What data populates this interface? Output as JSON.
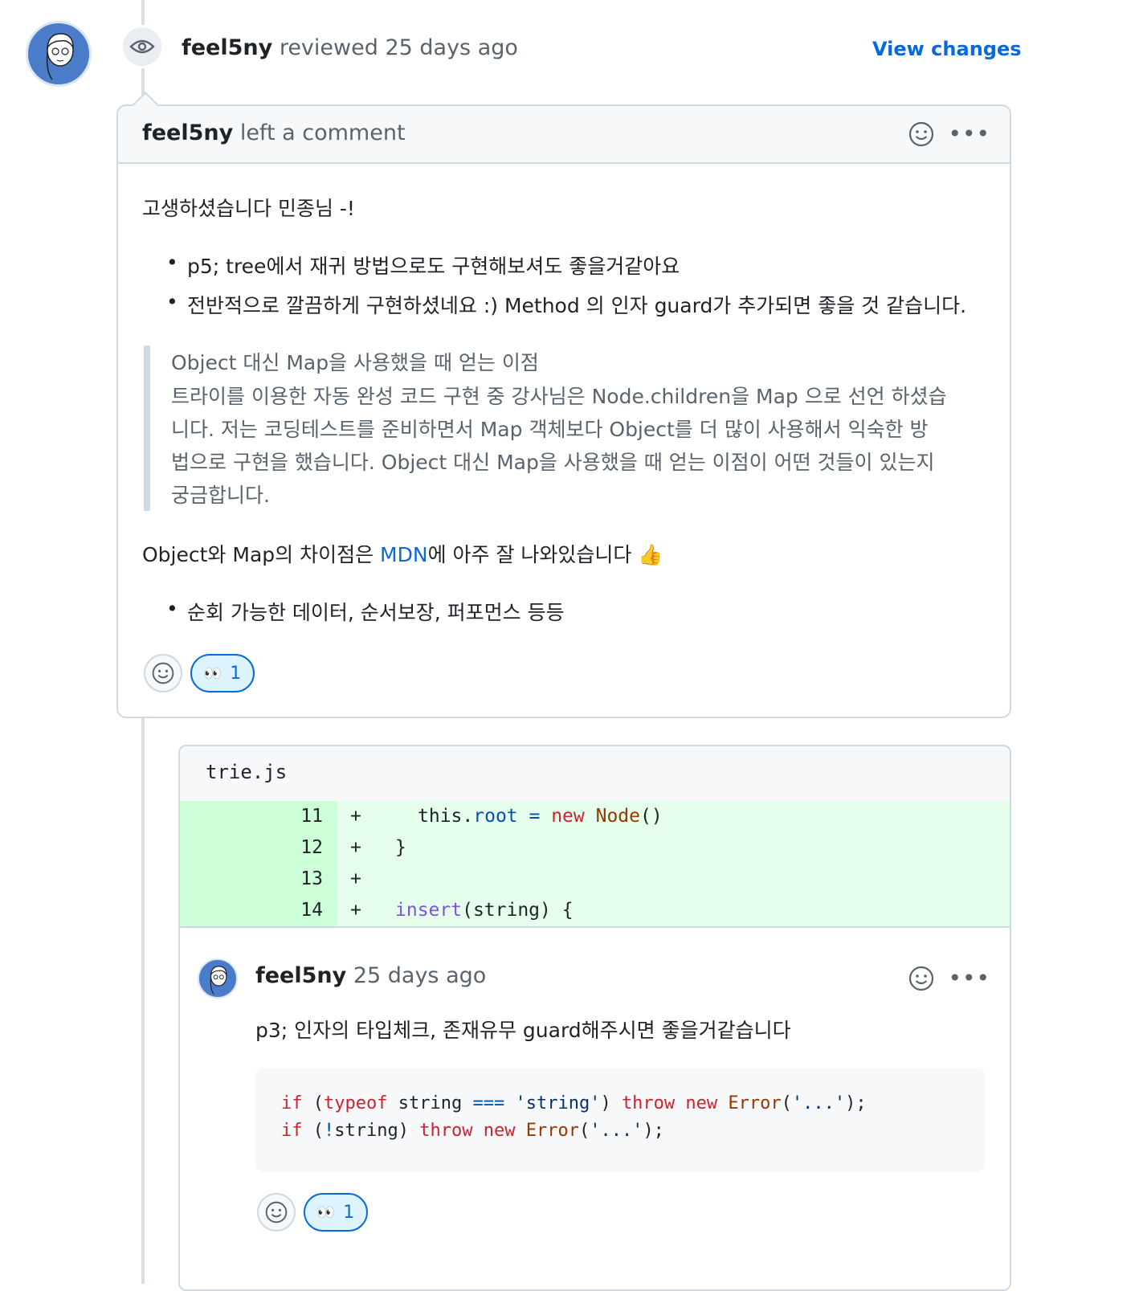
{
  "review": {
    "author": "feel5ny",
    "action": " reviewed ",
    "time": "25 days ago",
    "view_changes": "View changes"
  },
  "comment": {
    "author": "feel5ny",
    "action": " left a comment",
    "greeting": "고생하셨습니다 민종님 -!",
    "bullets": [
      "p5; tree에서 재귀 방법으로도 구현해보셔도 좋을거같아요",
      "전반적으로 깔끔하게 구현하셨네요 :) Method 의 인자 guard가 추가되면 좋을 것 같습니다."
    ],
    "quote_lines": [
      "Object 대신 Map을 사용했을 때 얻는 이점",
      "트라이를 이용한 자동 완성 코드 구현 중 강사님은 Node.children을 Map 으로 선언 하셨습",
      "니다. 저는 코딩테스트를 준비하면서 Map 객체보다 Object를 더 많이 사용해서 익숙한 방",
      "법으로 구현을 했습니다. Object 대신 Map을 사용했을 때 얻는 이점이 어떤 것들이 있는지",
      "궁금합니다."
    ],
    "mdn_before": "Object와 Map의 차이점은 ",
    "mdn_link": "MDN",
    "mdn_after": "에 아주 잘 나와있습니다 ",
    "thumbs": "👍",
    "bullet2": "순회 가능한 데이터, 순서보장, 퍼포먼스 등등",
    "reaction_emoji": "👀",
    "reaction_count": "1"
  },
  "diff": {
    "filename": "trie.js",
    "lines": [
      {
        "num": "11",
        "sign": "+"
      },
      {
        "num": "12",
        "sign": "+"
      },
      {
        "num": "13",
        "sign": "+"
      },
      {
        "num": "14",
        "sign": "+"
      }
    ],
    "code": {
      "l11_this": "this",
      "l11_dot": ".",
      "l11_root": "root",
      "l11_eq": " = ",
      "l11_new": "new",
      "l11_node": "Node",
      "l11_paren": "()",
      "l12": "}",
      "l14_insert": "insert",
      "l14_rest": "(string) {"
    }
  },
  "reply": {
    "author": "feel5ny",
    "time": " 25 days ago",
    "text": "p3; 인자의 타입체크, 존재유무 guard해주시면 좋을거같습니다",
    "code": {
      "if": "if",
      "typeof": "typeof",
      "string": "string",
      "teq": "===",
      "str_lit": "'string'",
      "throw": "throw",
      "new": "new",
      "error": "Error",
      "ellipsis": "'...'",
      "not": "!"
    },
    "reaction_emoji": "👀",
    "reaction_count": "1"
  },
  "icons": [
    "eye-icon",
    "smiley-icon",
    "kebab-icon",
    "avatar"
  ],
  "colors": {
    "link": "#0969da",
    "diff_add": "#e6ffec",
    "diff_gutter": "#ccffd8",
    "keyword": "#cf222e",
    "function": "#8250df",
    "constant": "#0550ae"
  }
}
